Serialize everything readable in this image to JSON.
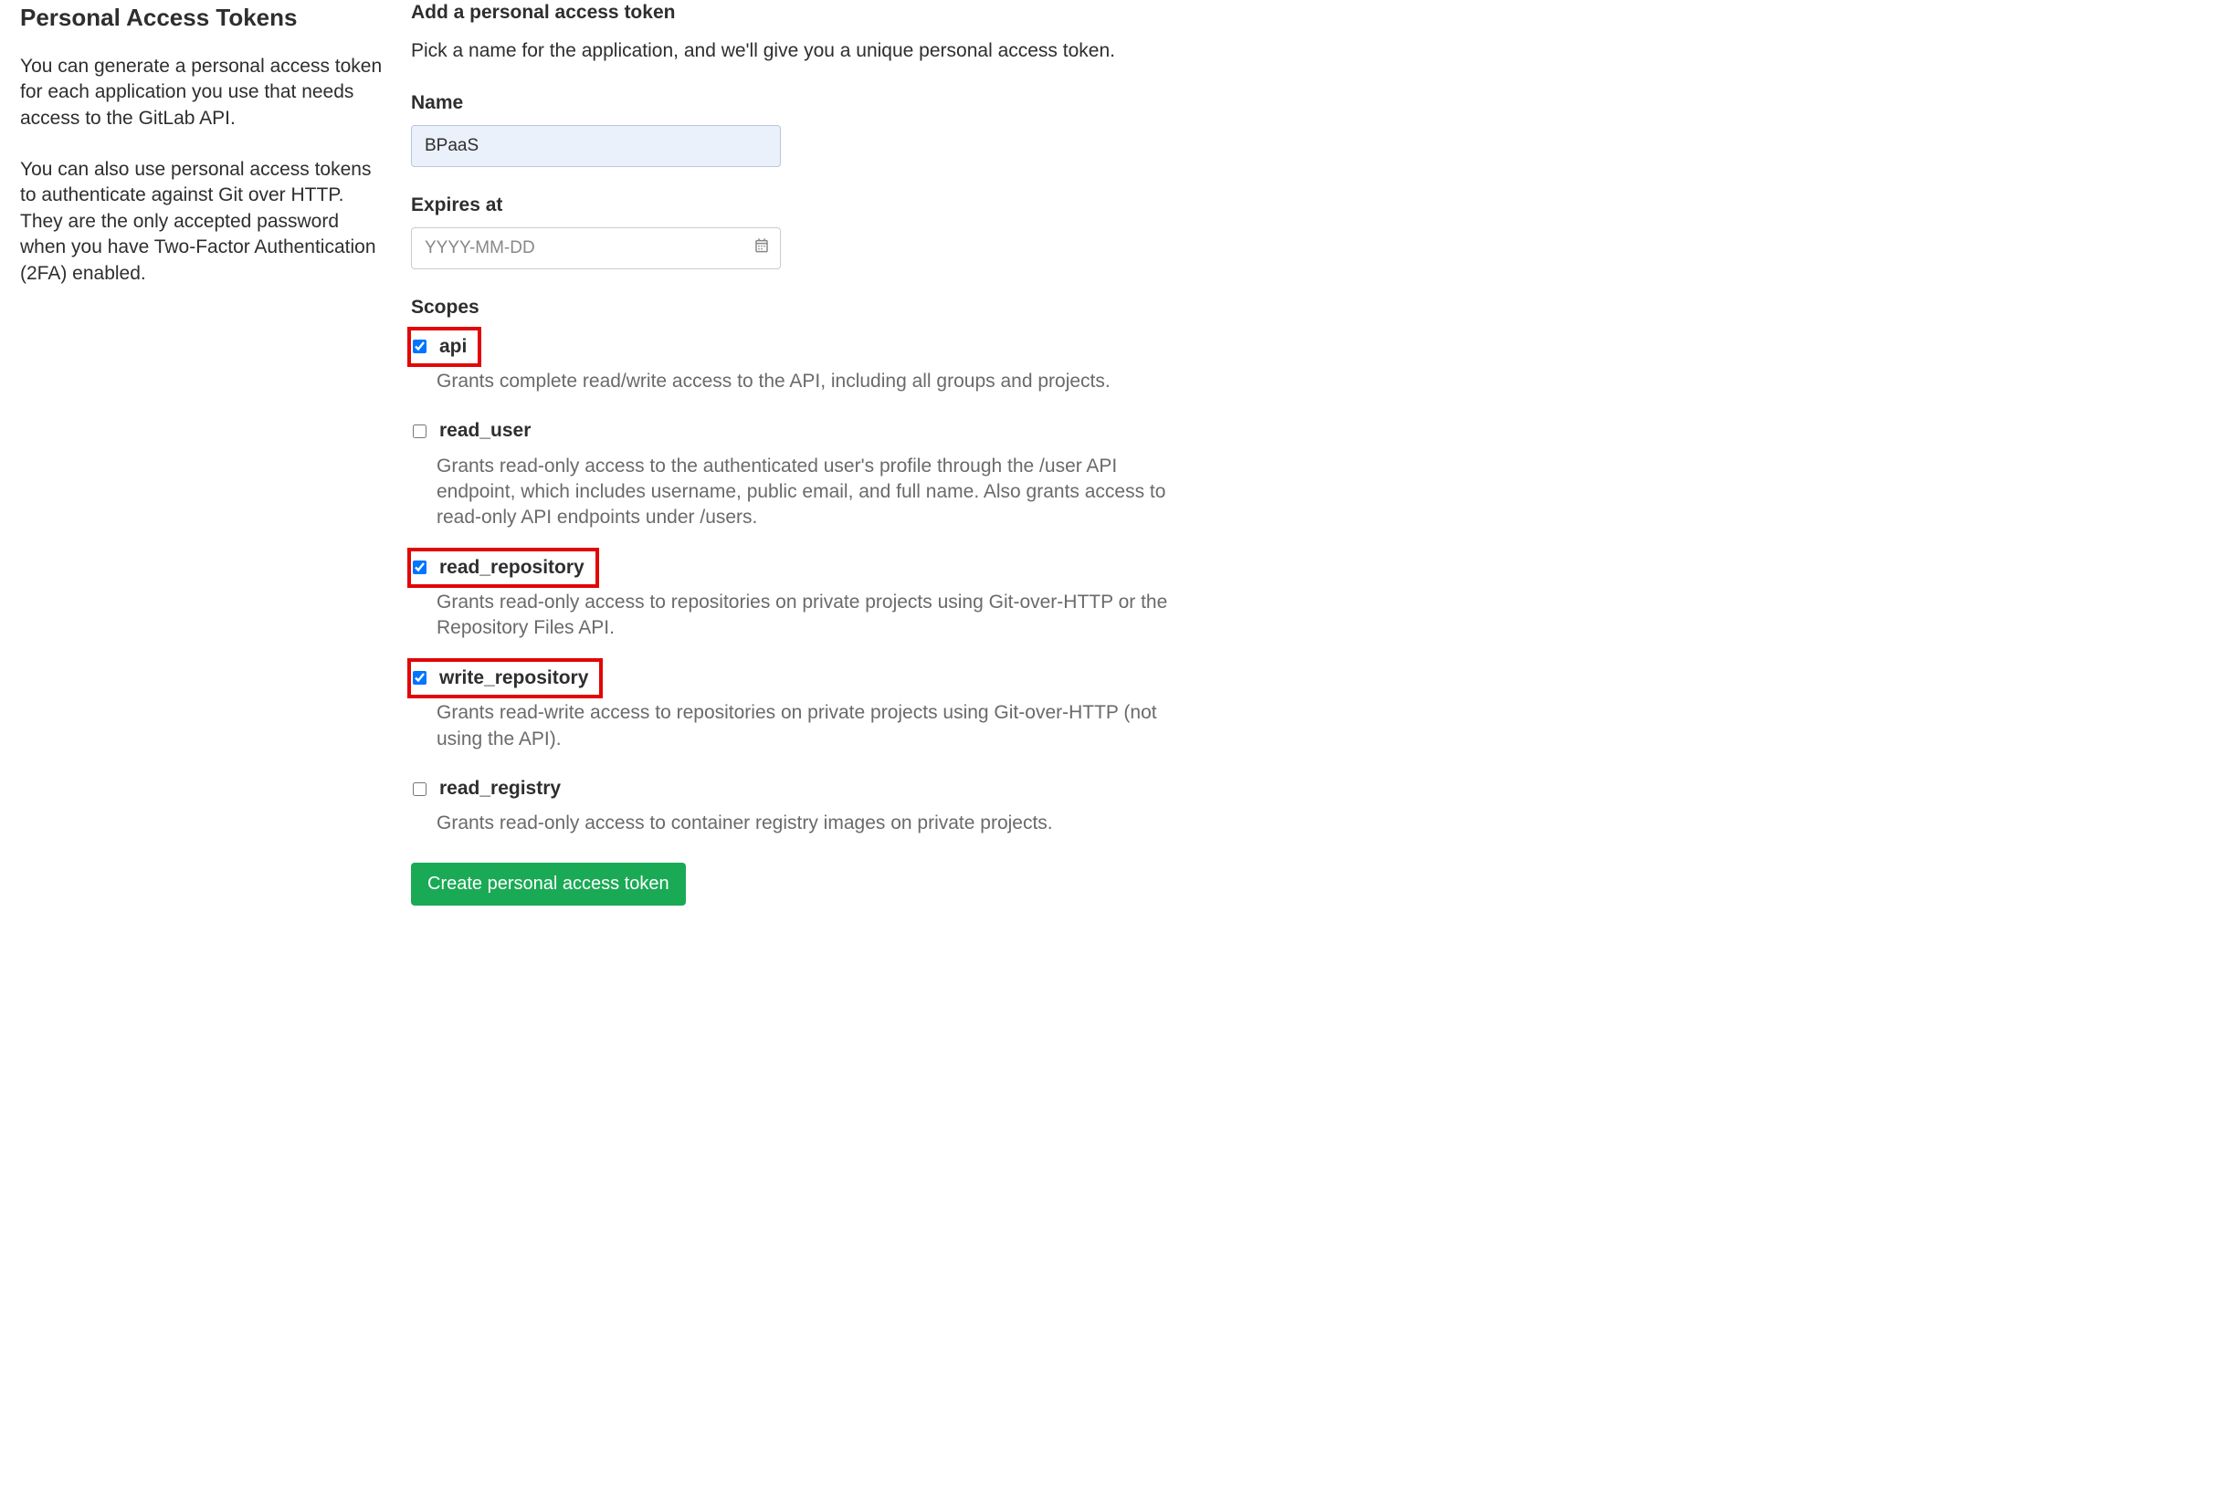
{
  "sidebar": {
    "title": "Personal Access Tokens",
    "paragraph1": "You can generate a personal access token for each application you use that needs access to the GitLab API.",
    "paragraph2": "You can also use personal access tokens to authenticate against Git over HTTP. They are the only accepted password when you have Two-Factor Authentication (2FA) enabled."
  },
  "form": {
    "heading": "Add a personal access token",
    "subtext": "Pick a name for the application, and we'll give you a unique personal access token.",
    "name_label": "Name",
    "name_value": "BPaaS",
    "expires_label": "Expires at",
    "expires_placeholder": "YYYY-MM-DD",
    "scopes_label": "Scopes",
    "scopes": [
      {
        "key": "api",
        "label": "api",
        "checked": true,
        "highlight": true,
        "desc": "Grants complete read/write access to the API, including all groups and projects."
      },
      {
        "key": "read_user",
        "label": "read_user",
        "checked": false,
        "highlight": false,
        "desc": "Grants read-only access to the authenticated user's profile through the /user API endpoint, which includes username, public email, and full name. Also grants access to read-only API endpoints under /users."
      },
      {
        "key": "read_repository",
        "label": "read_repository",
        "checked": true,
        "highlight": true,
        "desc": "Grants read-only access to repositories on private projects using Git-over-HTTP or the Repository Files API."
      },
      {
        "key": "write_repository",
        "label": "write_repository",
        "checked": true,
        "highlight": true,
        "desc": "Grants read-write access to repositories on private projects using Git-over-HTTP (not using the API)."
      },
      {
        "key": "read_registry",
        "label": "read_registry",
        "checked": false,
        "highlight": false,
        "desc": "Grants read-only access to container registry images on private projects."
      }
    ],
    "submit_label": "Create personal access token"
  }
}
